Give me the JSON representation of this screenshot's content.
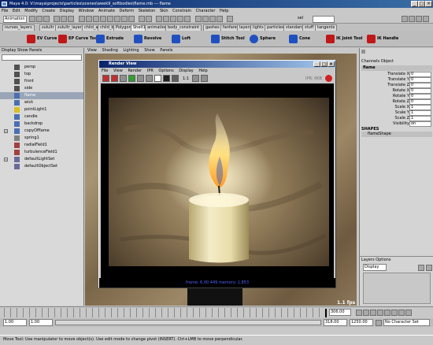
{
  "window": {
    "title": "Maya 4.0: V:\\maya\\projects\\particles\\scenes\\week9_softbodies\\flame.mb  ---  flame"
  },
  "menubar": [
    "File",
    "Edit",
    "Modify",
    "Create",
    "Display",
    "Window",
    "Animate",
    "Deform",
    "Skeleton",
    "Skin",
    "Constrain",
    "Character",
    "Help"
  ],
  "status": {
    "mode": "Animation",
    "sel_label": "sel"
  },
  "shelf_tabs": [
    "nurves_layers",
    "zulultr",
    "zulultr_layers",
    "child_a",
    "child_b",
    "Polygons",
    "Shelf1",
    "animation",
    "body_constraint",
    "gashes",
    "fanfare",
    "layers",
    "lights",
    "particles",
    "standard",
    "stuff",
    "tangents"
  ],
  "shelf_active": "Shelf1",
  "shelf_tools": [
    {
      "label": "EV Curve Tool",
      "color": "#c01818"
    },
    {
      "label": "EP Curve Tool",
      "color": "#c01818"
    },
    {
      "label": "Extrude",
      "color": "#2050c0"
    },
    {
      "label": "Revolve",
      "color": "#2050c0"
    },
    {
      "label": "Loft",
      "color": "#2050c0"
    },
    {
      "label": "Stitch Tool",
      "color": "#2050c0"
    },
    {
      "label": "Sphere",
      "color": "#2050c0"
    },
    {
      "label": "Cone",
      "color": "#2050c0"
    },
    {
      "label": "IK Joint Tool",
      "color": "#c01818"
    },
    {
      "label": "IK Handle",
      "color": "#c01818"
    }
  ],
  "outliner": {
    "menu": [
      "Display",
      "Show",
      "Panels"
    ],
    "items": [
      {
        "label": "persp",
        "icon": "camera-icon",
        "selected": false,
        "expand": false
      },
      {
        "label": "top",
        "icon": "camera-icon",
        "selected": false,
        "expand": false
      },
      {
        "label": "front",
        "icon": "camera-icon",
        "selected": false,
        "expand": false
      },
      {
        "label": "side",
        "icon": "camera-icon",
        "selected": false,
        "expand": false
      },
      {
        "label": "flame",
        "icon": "curve-icon",
        "selected": true,
        "expand": false
      },
      {
        "label": "wick",
        "icon": "curve-icon",
        "selected": false,
        "expand": false
      },
      {
        "label": "pointLight1",
        "icon": "light-icon",
        "selected": false,
        "expand": false
      },
      {
        "label": "candle",
        "icon": "curve-icon",
        "selected": false,
        "expand": false
      },
      {
        "label": "backdrop",
        "icon": "curve-icon",
        "selected": false,
        "expand": false
      },
      {
        "label": "copyOfflame",
        "icon": "curve-icon",
        "selected": false,
        "expand": true
      },
      {
        "label": "spring1",
        "icon": "spring-icon",
        "selected": false,
        "expand": false
      },
      {
        "label": "radialField1",
        "icon": "field-icon",
        "selected": false,
        "expand": false
      },
      {
        "label": "turbulenceField1",
        "icon": "field-icon",
        "selected": false,
        "expand": false
      },
      {
        "label": "defaultLightSet",
        "icon": "set-icon",
        "selected": false,
        "expand": true
      },
      {
        "label": "defaultObjectSet",
        "icon": "set-icon",
        "selected": false,
        "expand": false
      }
    ]
  },
  "viewport": {
    "menu": [
      "View",
      "Shading",
      "Lighting",
      "Show",
      "Panels"
    ],
    "fps": "1.1 fps"
  },
  "render_view": {
    "title": "Render View",
    "menu": [
      "File",
      "View",
      "Render",
      "IPR",
      "Options",
      "Display",
      "Help"
    ],
    "ratio": "1:1",
    "ipr_label": "IPR: 0KB",
    "info": "frame: 6.00   449 memory: 1.853"
  },
  "channels": {
    "menu": [
      "Channels",
      "Object"
    ],
    "object": "flame",
    "attrs": [
      {
        "name": "Translate X",
        "value": "0"
      },
      {
        "name": "Translate Y",
        "value": "0"
      },
      {
        "name": "Translate Z",
        "value": "0"
      },
      {
        "name": "Rotate X",
        "value": "0"
      },
      {
        "name": "Rotate Y",
        "value": "0"
      },
      {
        "name": "Rotate Z",
        "value": "0"
      },
      {
        "name": "Scale X",
        "value": "1"
      },
      {
        "name": "Scale Y",
        "value": "1"
      },
      {
        "name": "Scale Z",
        "value": "1"
      },
      {
        "name": "Visibility",
        "value": "on"
      }
    ],
    "shapes_label": "SHAPES",
    "shape": "flameShape"
  },
  "layers": {
    "menu": [
      "Layers",
      "Options"
    ],
    "mode": "Display"
  },
  "time": {
    "current": "306.00",
    "start": "1.00",
    "end_field": "1.00",
    "range_end": "318.00",
    "anim_end": "1250.00",
    "character": "No Character Set"
  },
  "help": "Move Tool: Use manipulator to move object(s). Use edit mode to change pivot (INSERT). Ctrl+LMB to move perpendicular."
}
